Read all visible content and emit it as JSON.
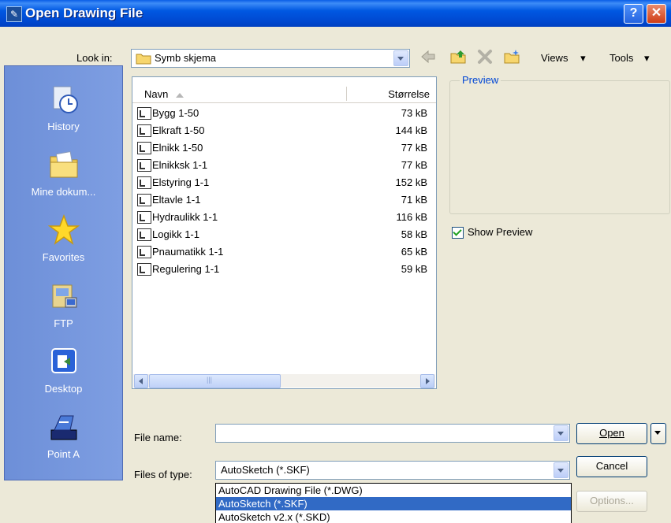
{
  "window": {
    "title": "Open Drawing File"
  },
  "toolbar": {
    "look_in_label": "Look in:",
    "look_in_value": "Symb skjema",
    "views_label": "Views",
    "tools_label": "Tools"
  },
  "places": [
    {
      "label": "History",
      "icon": "history-icon"
    },
    {
      "label": "Mine dokum...",
      "icon": "my-documents-icon"
    },
    {
      "label": "Favorites",
      "icon": "favorites-icon"
    },
    {
      "label": "FTP",
      "icon": "ftp-icon"
    },
    {
      "label": "Desktop",
      "icon": "desktop-icon"
    },
    {
      "label": "Point A",
      "icon": "point-a-icon"
    }
  ],
  "file_list": {
    "columns": [
      "Navn",
      "Størrelse"
    ],
    "rows": [
      {
        "name": "Bygg 1-50",
        "size": "73 kB"
      },
      {
        "name": "Elkraft 1-50",
        "size": "144 kB"
      },
      {
        "name": "Elnikk 1-50",
        "size": "77 kB"
      },
      {
        "name": "Elnikksk 1-1",
        "size": "77 kB"
      },
      {
        "name": "Elstyring 1-1",
        "size": "152 kB"
      },
      {
        "name": "Eltavle 1-1",
        "size": "71 kB"
      },
      {
        "name": "Hydraulikk 1-1",
        "size": "116 kB"
      },
      {
        "name": "Logikk 1-1",
        "size": "58 kB"
      },
      {
        "name": "Pnaumatikk 1-1",
        "size": "65 kB"
      },
      {
        "name": "Regulering 1-1",
        "size": "59 kB"
      }
    ]
  },
  "preview": {
    "caption": "Preview",
    "show_preview_label": "Show Preview",
    "show_preview_checked": true
  },
  "form": {
    "file_name_label": "File name:",
    "file_name_value": "",
    "files_of_type_label": "Files of type:",
    "files_of_type_value": "AutoSketch (*.SKF)"
  },
  "buttons": {
    "open": "Open",
    "cancel": "Cancel",
    "options": "Options..."
  },
  "type_options": [
    {
      "label": "AutoCAD Drawing File (*.DWG)",
      "selected": false
    },
    {
      "label": "AutoSketch (*.SKF)",
      "selected": true
    },
    {
      "label": "AutoSketch v2.x (*.SKD)",
      "selected": false
    }
  ],
  "colors": {
    "title_bar": "#0054e3",
    "places_bar": "#7896dc",
    "selection": "#316ac5",
    "preview_caption": "#0046d5"
  }
}
